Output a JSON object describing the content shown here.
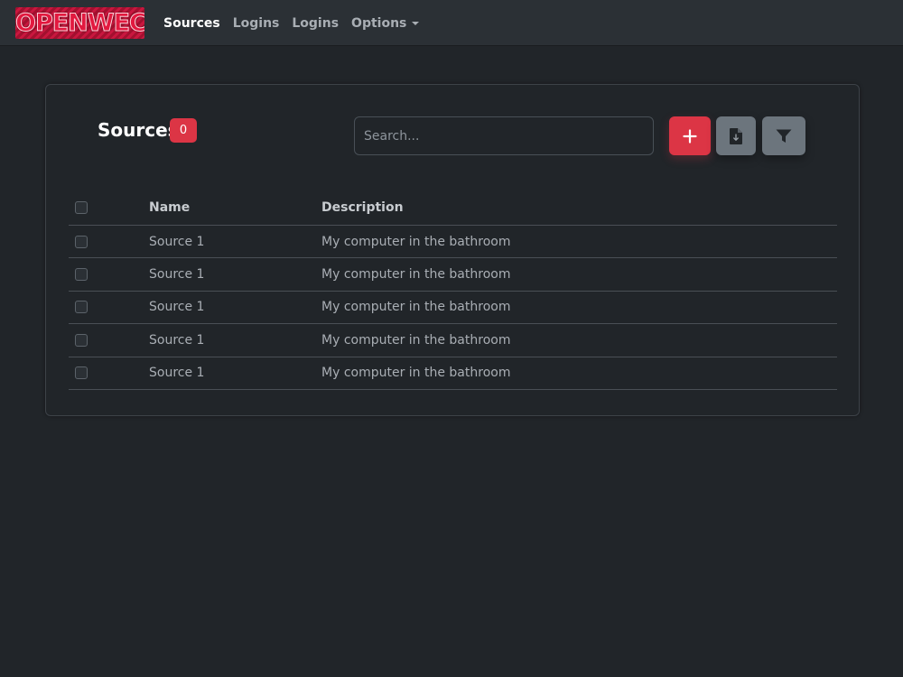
{
  "navbar": {
    "logo_text": "OPENWEC",
    "links": [
      {
        "label": "Sources",
        "active": true
      },
      {
        "label": "Logins",
        "active": false
      },
      {
        "label": "Logins",
        "active": false
      }
    ],
    "options_label": "Options"
  },
  "sources": {
    "title": "Sources",
    "count": "0",
    "search_placeholder": "Search...",
    "add_icon": "plus-icon",
    "file_icon": "file-icon",
    "filter_icon": "filter-icon"
  },
  "table": {
    "headers": {
      "name": "Name",
      "description": "Description"
    },
    "rows": [
      {
        "name": "Source 1",
        "description": "My computer in the bathroom"
      },
      {
        "name": "Source 1",
        "description": "My computer in the bathroom"
      },
      {
        "name": "Source 1",
        "description": "My computer in the bathroom"
      },
      {
        "name": "Source 1",
        "description": "My computer in the bathroom"
      },
      {
        "name": "Source 1",
        "description": "My computer in the bathroom"
      }
    ]
  },
  "colors": {
    "accent": "#dc3545",
    "background": "#212529",
    "navbar": "#2b3035",
    "secondary": "#6c757d"
  }
}
